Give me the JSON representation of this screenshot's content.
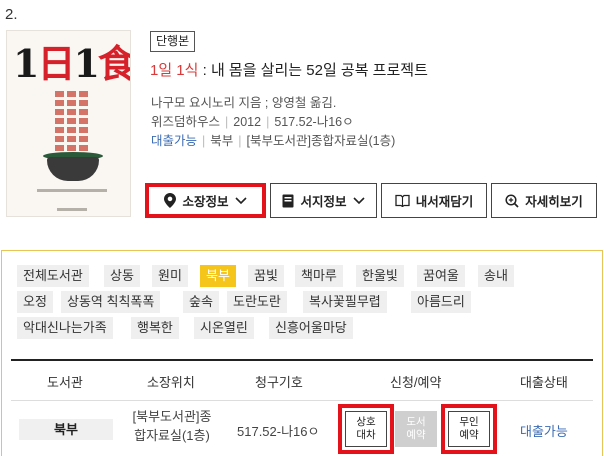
{
  "item_number": "2.",
  "book": {
    "cover_title_parts": [
      "1",
      "日",
      "1",
      "食"
    ],
    "badge": "단행본",
    "title_highlight": "1일 1식",
    "title_rest": " : 내 몸을 살리는 52일 공복 프로젝트",
    "authors": "나구모 요시노리 지음 ; 양영철 옮김.",
    "publisher": "위즈덤하우스",
    "year": "2012",
    "call_number": "517.52-나16ㅇ",
    "loan_status": "대출가능",
    "branch": "북부",
    "location": "[북부도서관]종합자료실(1층)"
  },
  "actions": {
    "holdings": "소장정보",
    "bibliographic": "서지정보",
    "my_shelf": "내서재담기",
    "details": "자세히보기"
  },
  "libraries": [
    "전체도서관",
    "상동",
    "원미",
    "북부",
    "꿈빛",
    "책마루",
    "한울빛",
    "꿈여울",
    "송내",
    "오정",
    "상동역 칙칙폭폭",
    "숲속",
    "도란도란",
    "복사꽃필무렵",
    "아름드리",
    "악대신나는가족",
    "행복한",
    "시온열린",
    "신흥어울마당"
  ],
  "active_library": "북부",
  "table": {
    "headers": [
      "도서관",
      "소장위치",
      "청구기호",
      "신청/예약",
      "대출상태"
    ],
    "row": {
      "library": "북부",
      "location": "[북부도서관]종합자료실(1층)",
      "call_number": "517.52-나16ㅇ",
      "interlibrary_loan": "상호\n대차",
      "book_reservation": "도서\n예약",
      "unmanned_reservation": "무인\n예약",
      "status": "대출가능"
    }
  },
  "colors": {
    "highlight_red": "#e3121b",
    "title_red": "#d73b3b",
    "link_blue": "#3b6bb3",
    "active_tag": "#f5c51c",
    "panel_border": "#e8c457"
  }
}
